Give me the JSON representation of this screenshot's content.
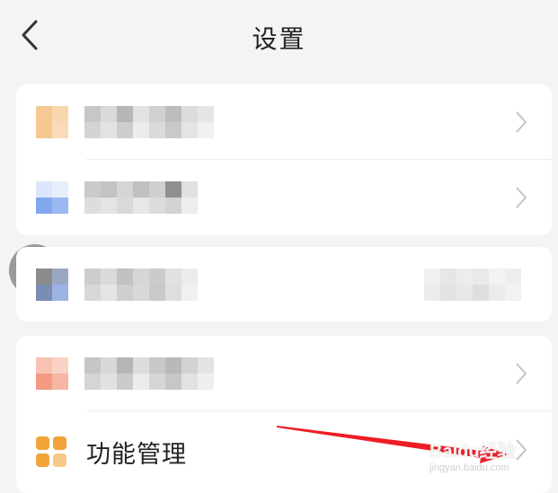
{
  "header": {
    "title": "设置",
    "back_icon": "chevron-left-icon"
  },
  "colors": {
    "background": "#f4f4f4",
    "card": "#ffffff",
    "chevron": "#c4c4c4",
    "feature_icon": "#f2a33a",
    "annotation_arrow": "#ee1c24"
  },
  "settings": {
    "feature_management": {
      "label": "功能管理",
      "icon": "grid-apps-icon"
    }
  },
  "watermark": {
    "main": "Baidu经验",
    "sub": "jingyan.baidu.com"
  }
}
